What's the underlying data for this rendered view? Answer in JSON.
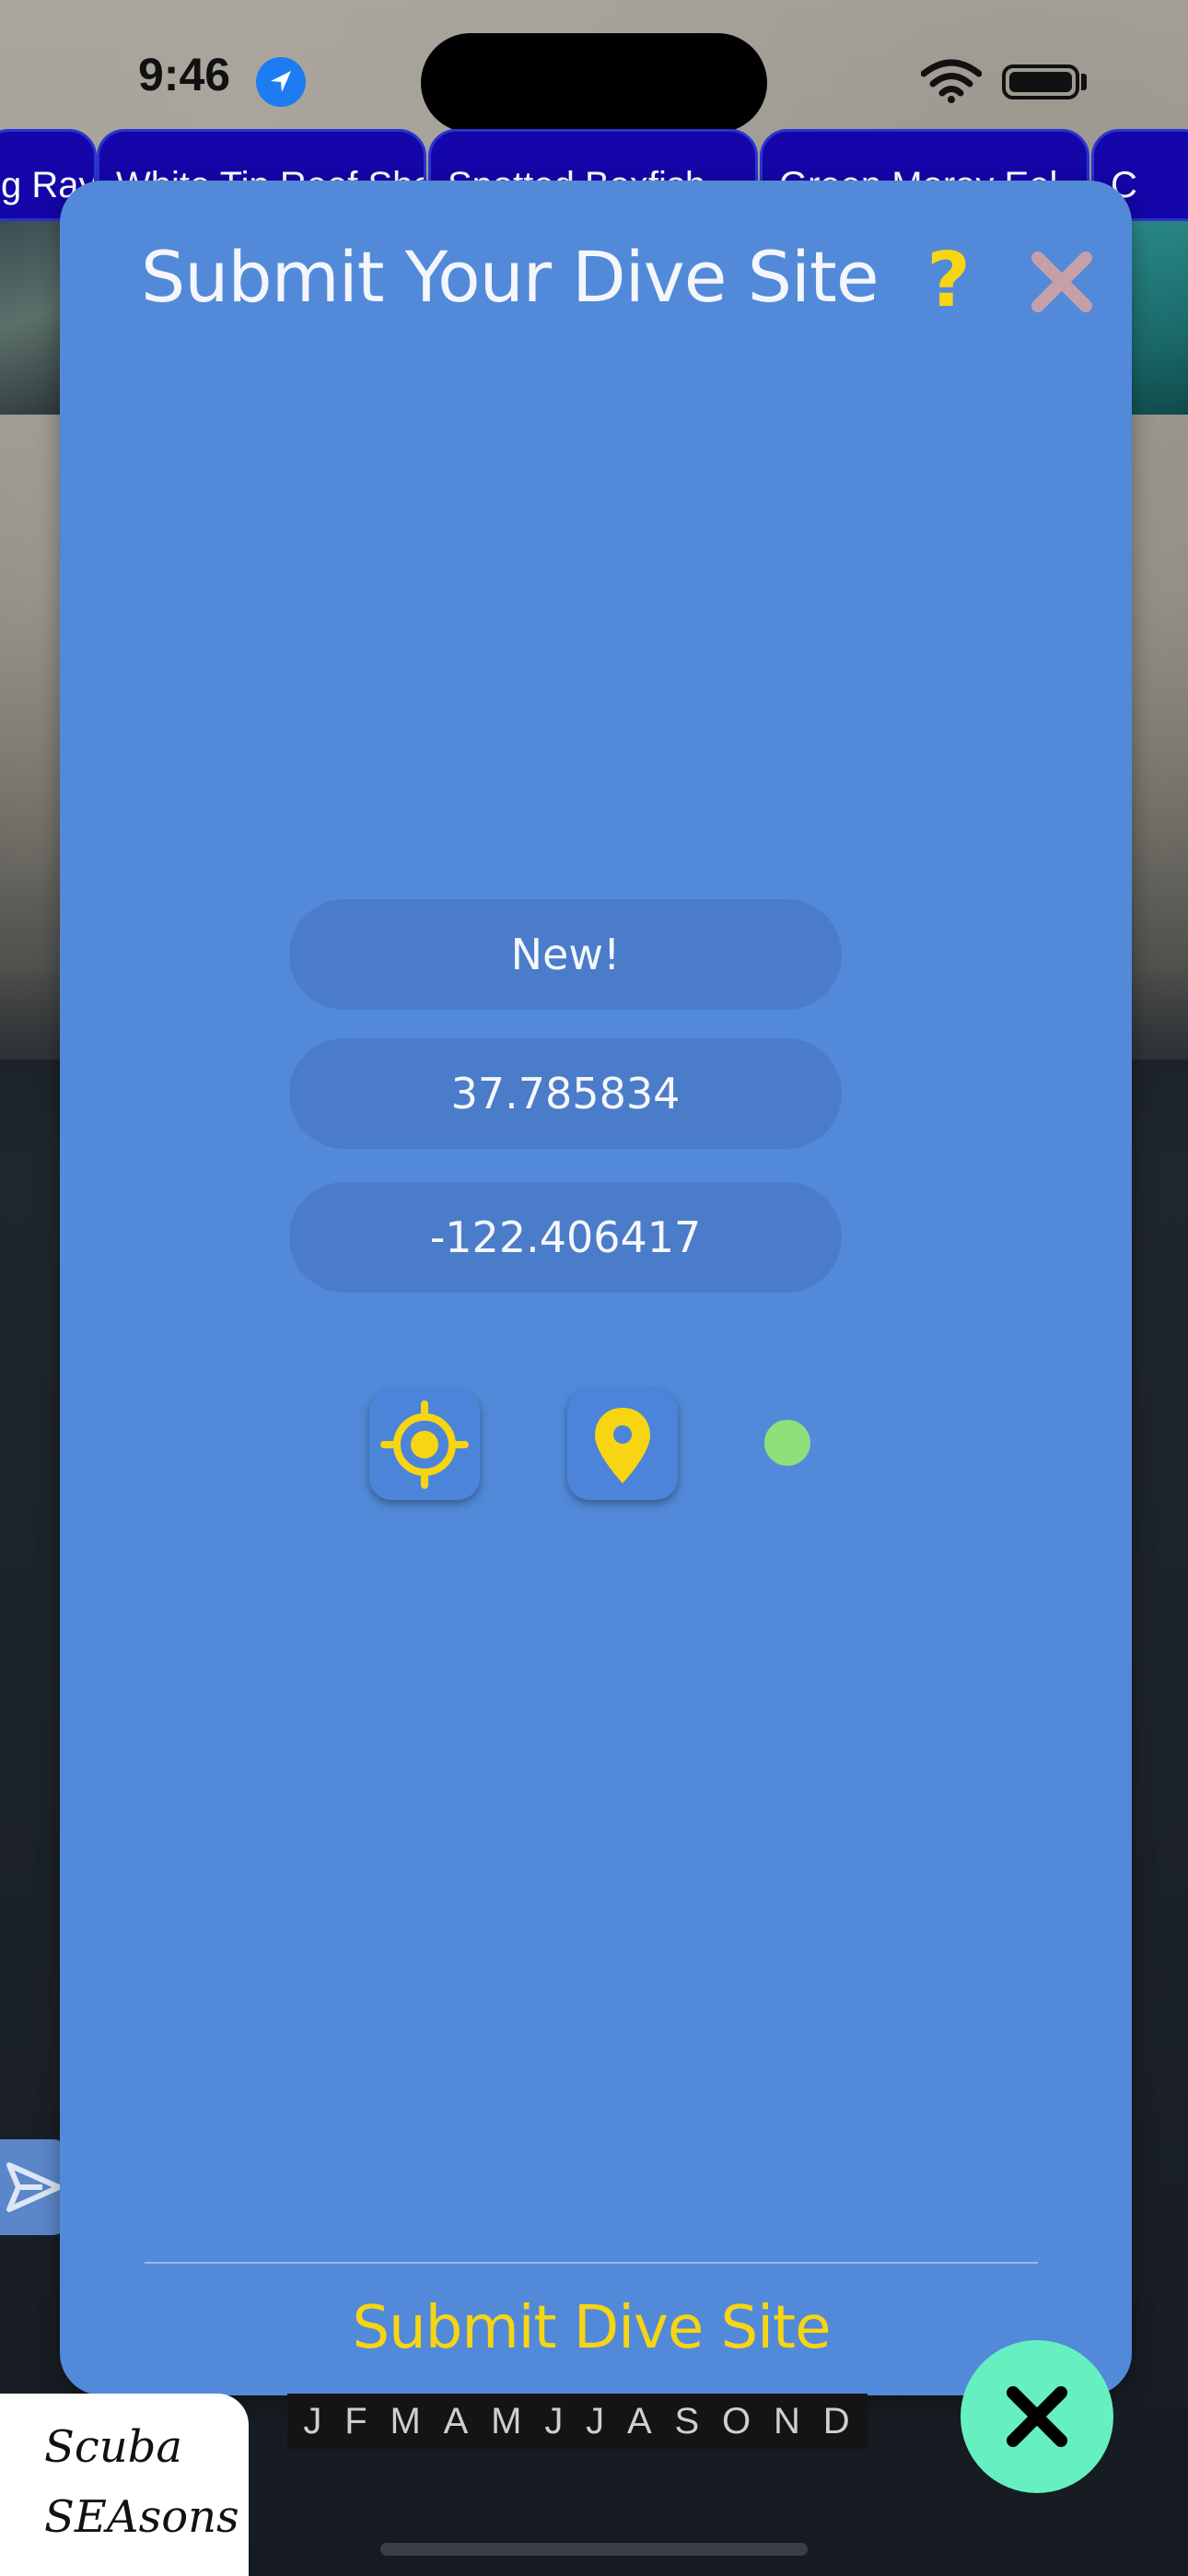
{
  "status_bar": {
    "time": "9:46"
  },
  "species_tabs": [
    "g Ray",
    "White Tip Reef Shar",
    "Spotted Boxfish",
    "Green Moray Eel",
    "C"
  ],
  "modal": {
    "title": "Submit Your Dive Site",
    "help_label": "?",
    "fields": {
      "site_name": {
        "value": "New!"
      },
      "latitude": {
        "value": "37.785834"
      },
      "longitude": {
        "value": "-122.406417"
      }
    },
    "submit_label": "Submit Dive Site"
  },
  "brand": {
    "line1": "Scuba",
    "line2": "SEAsons"
  },
  "months": [
    "J",
    "F",
    "M",
    "A",
    "M",
    "J",
    "J",
    "A",
    "S",
    "O",
    "N",
    "D"
  ],
  "colors": {
    "modal_bg": "#528ad9",
    "accent_yellow": "#f7d512",
    "status_dot": "#8ee07b",
    "fab": "#66f0c2",
    "tab_bg": "#1406a8"
  },
  "icons": [
    "location-arrow-icon",
    "wifi-icon",
    "battery-icon",
    "help-icon",
    "close-icon",
    "crosshair-gps-icon",
    "map-pin-icon",
    "send-icon",
    "fab-close-icon"
  ]
}
